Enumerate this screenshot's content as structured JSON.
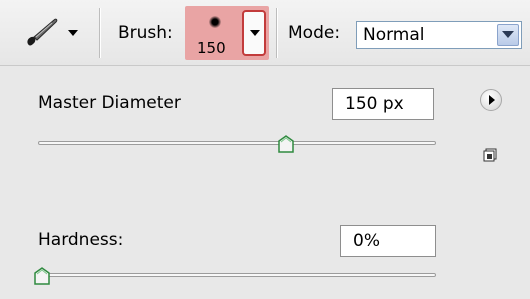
{
  "toolbar": {
    "tool_icon": "brush-tool-icon",
    "brush_label": "Brush:",
    "brush_size": "150",
    "mode_label": "Mode:",
    "mode_value": "Normal"
  },
  "panel": {
    "master_diameter_label": "Master Diameter",
    "master_diameter_value": "150 px",
    "master_diameter_slider_fraction": 0.63,
    "hardness_label": "Hardness:",
    "hardness_value": "0%",
    "hardness_slider_fraction": 0.0,
    "menu_icon": "flyout-menu-icon",
    "new_preset_icon": "new-preset-icon"
  },
  "colors": {
    "brush_highlight": "#e9a4a4",
    "slider_thumb": "#3a9a4a"
  }
}
